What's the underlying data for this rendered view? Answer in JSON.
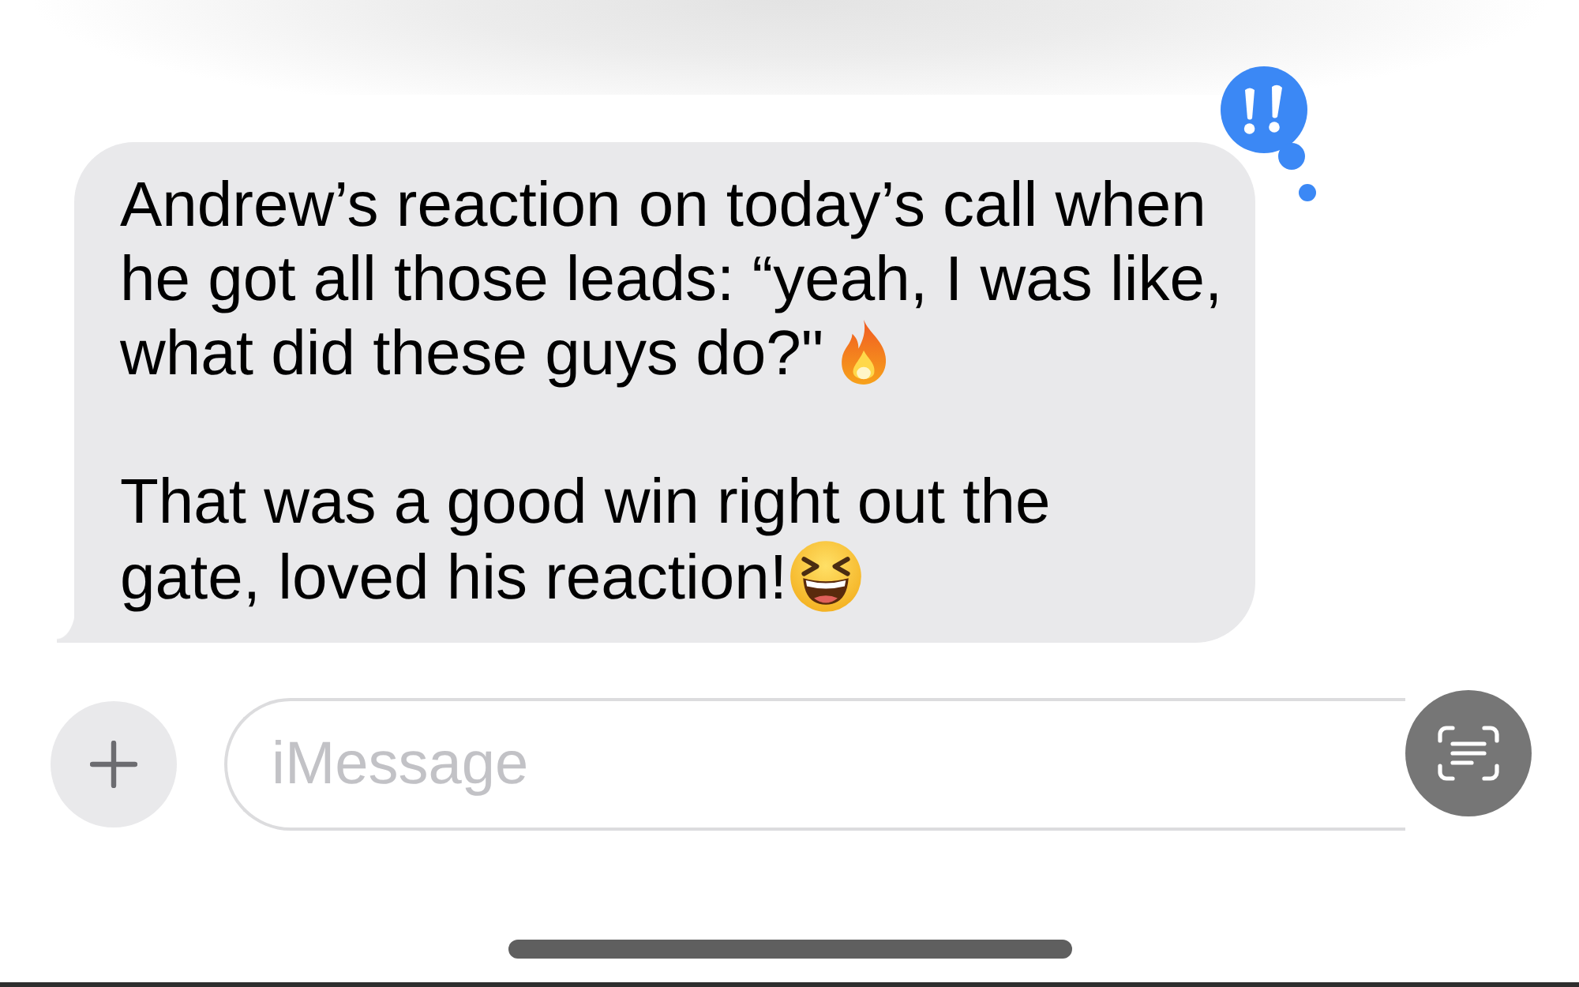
{
  "conversation": {
    "messages": [
      {
        "outgoing": false,
        "emphasized": true,
        "paragraphs": [
          {
            "parts": [
              {
                "kind": "text",
                "lines": [
                  "Andrew’s reaction on today’s call when",
                  "he got all those leads: “yeah, I was like,",
                  "what did these guys do?\""
                ]
              },
              {
                "kind": "fire"
              }
            ]
          },
          {
            "parts": [
              {
                "kind": "text",
                "lines": [
                  "That was a good win right out the",
                  "gate, loved his reaction!"
                ]
              },
              {
                "kind": "laughing"
              }
            ]
          }
        ]
      }
    ]
  },
  "composer": {
    "placeholder": "iMessage"
  }
}
